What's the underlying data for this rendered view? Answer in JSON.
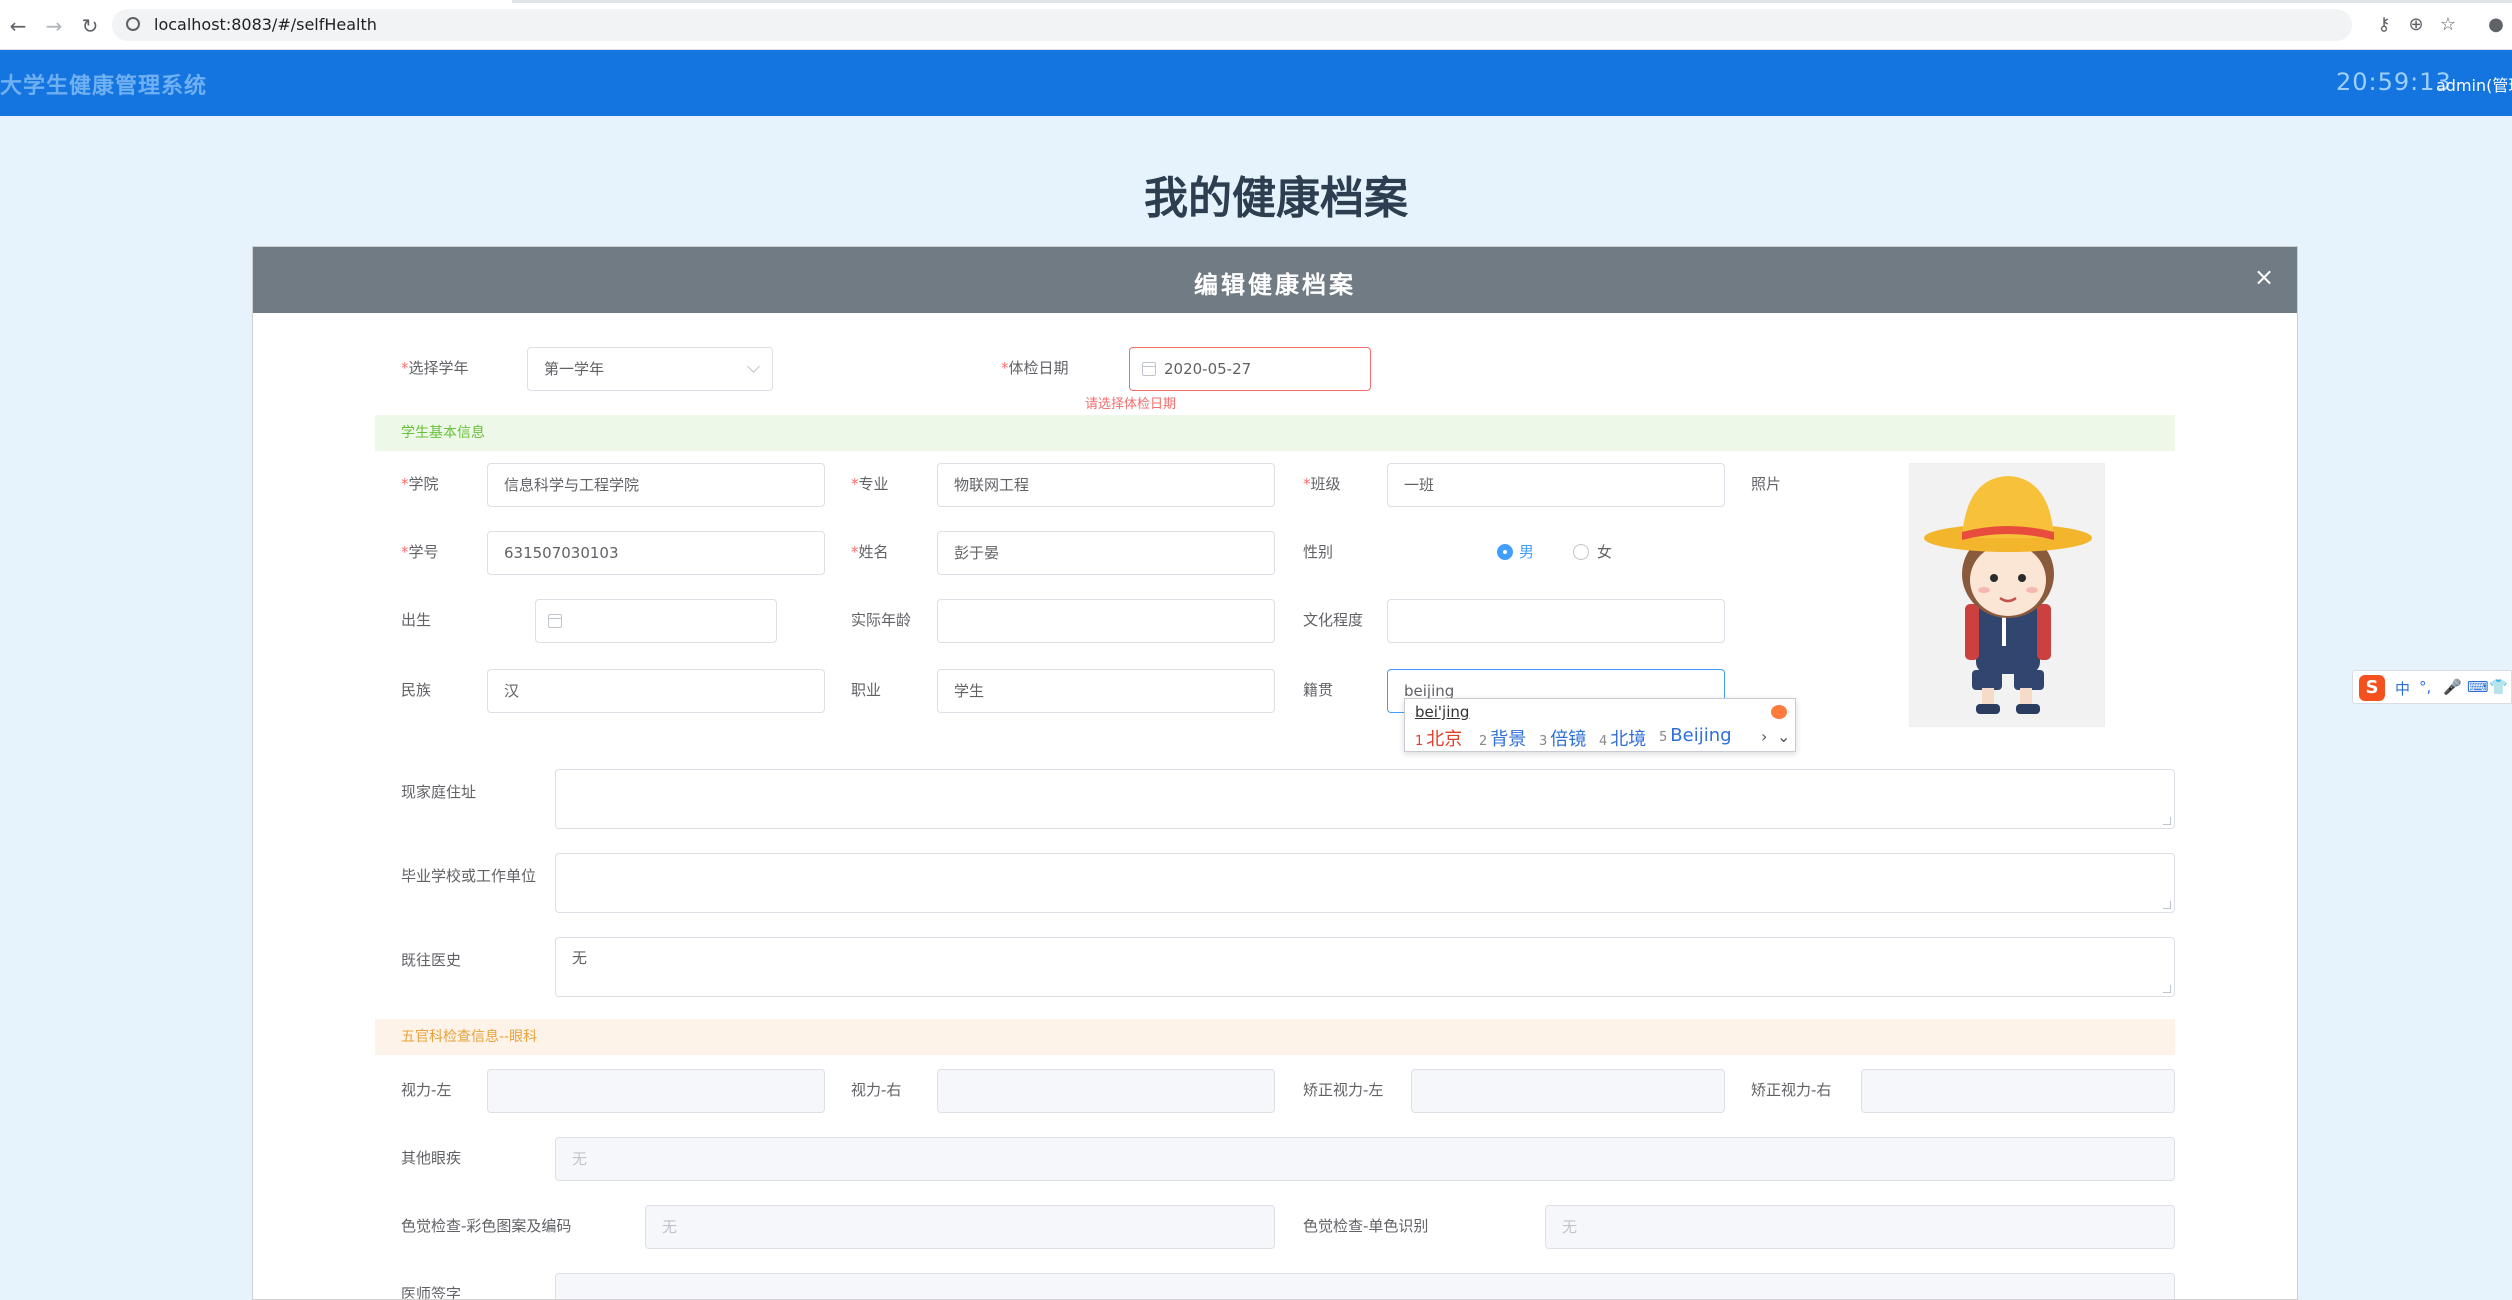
{
  "browser": {
    "url": "localhost:8083/#/selfHealth",
    "back_icon": "back-arrow-icon",
    "forward_icon": "forward-arrow-icon",
    "reload_icon": "reload-icon"
  },
  "header": {
    "app_title": "大学生健康管理系统",
    "time": "20:59:13",
    "user": "admin(管理"
  },
  "page": {
    "heading": "我的健康档案"
  },
  "dialog": {
    "title": "编辑健康档案",
    "close": "×"
  },
  "form": {
    "year_label": "选择学年",
    "year_value": "第一学年",
    "exam_date_label": "体检日期",
    "exam_date_value": "2020-05-27",
    "exam_date_error": "请选择体检日期",
    "section_basic": "学生基本信息",
    "college_label": "学院",
    "college_value": "信息科学与工程学院",
    "major_label": "专业",
    "major_value": "物联网工程",
    "class_label": "班级",
    "class_value": "一班",
    "photo_label": "照片",
    "student_id_label": "学号",
    "student_id_value": "631507030103",
    "name_label": "姓名",
    "name_value": "彭于晏",
    "gender_label": "性别",
    "gender_male": "男",
    "gender_female": "女",
    "gender_selected": "男",
    "birth_label": "出生",
    "birth_value": "",
    "age_label": "实际年龄",
    "age_value": "",
    "education_label": "文化程度",
    "education_value": "",
    "ethnicity_label": "民族",
    "ethnicity_value": "汉",
    "occupation_label": "职业",
    "occupation_value": "学生",
    "native_label": "籍贯",
    "native_value": "beijing",
    "address_label": "现家庭住址",
    "address_value": "",
    "school_label": "毕业学校或工作单位",
    "school_value": "",
    "history_label": "既往医史",
    "history_value": "无",
    "section_eye": "五官科检查信息--眼科",
    "vision_left_label": "视力-左",
    "vision_right_label": "视力-右",
    "corrected_left_label": "矫正视力-左",
    "corrected_right_label": "矫正视力-右",
    "other_eye_label": "其他眼疾",
    "other_eye_value": "无",
    "color_pattern_label": "色觉检查-彩色图案及编码",
    "color_pattern_value": "无",
    "color_single_label": "色觉检查-单色识别",
    "color_single_value": "无",
    "doctor_sign_label": "医师签字"
  },
  "ime": {
    "composition": "bei'jing",
    "candidates": [
      {
        "num": "1",
        "text": "北京"
      },
      {
        "num": "2",
        "text": "背景"
      },
      {
        "num": "3",
        "text": "倍镜"
      },
      {
        "num": "4",
        "text": "北境"
      },
      {
        "num": "5",
        "text": "Beijing"
      }
    ],
    "nav_next": "›",
    "nav_more": "⌄",
    "toolbar_logo": "S",
    "toolbar_items": [
      "中",
      "°,",
      "🎤",
      "⌨",
      "👕"
    ]
  },
  "colors": {
    "header_bg": "#1474e0",
    "page_bg": "#e6f3fc",
    "dialog_header_bg": "#717b84",
    "error": "#f56c6c",
    "primary": "#409eff"
  }
}
